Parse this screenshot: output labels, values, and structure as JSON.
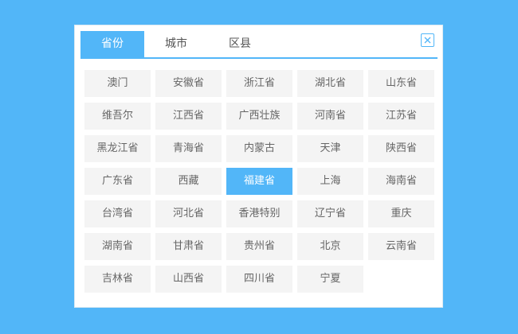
{
  "tabs": [
    {
      "label": "省份",
      "active": true
    },
    {
      "label": "城市",
      "active": false
    },
    {
      "label": "区县",
      "active": false
    }
  ],
  "close_icon": "close-icon",
  "selected_province": "福建省",
  "provinces": [
    "澳门",
    "安徽省",
    "浙江省",
    "湖北省",
    "山东省",
    "维吾尔",
    "江西省",
    "广西壮族",
    "河南省",
    "江苏省",
    "黑龙江省",
    "青海省",
    "内蒙古",
    "天津",
    "陕西省",
    "广东省",
    "西藏",
    "福建省",
    "上海",
    "海南省",
    "台湾省",
    "河北省",
    "香港特别",
    "辽宁省",
    "重庆",
    "湖南省",
    "甘肃省",
    "贵州省",
    "北京",
    "云南省",
    "吉林省",
    "山西省",
    "四川省",
    "宁夏"
  ],
  "colors": {
    "accent": "#52b6f8",
    "background": "#52b6f8",
    "cell_bg": "#f4f4f4",
    "cell_text": "#666666"
  }
}
